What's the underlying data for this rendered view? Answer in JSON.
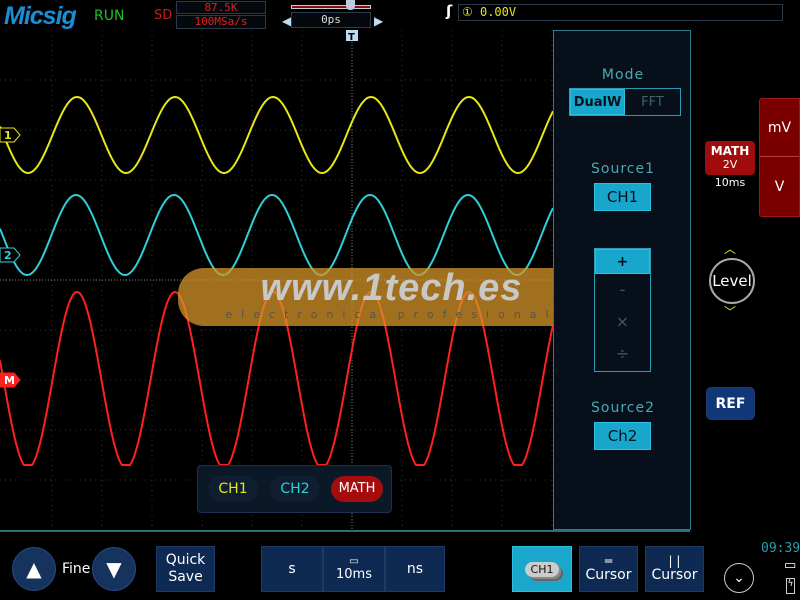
{
  "header": {
    "brand": "Micsig",
    "status": "RUN",
    "mode": "SD",
    "memory_depth": "87.5K",
    "sample_rate": "100MSa/s",
    "trigger_position": "0ps",
    "trigger_info": "① 0.00V",
    "trigger_slope_icon": "rising-edge-icon"
  },
  "channels": {
    "ch1_marker": "1",
    "ch2_marker": "2",
    "math_marker": "M",
    "trigger_marker": "T"
  },
  "colors": {
    "ch1": "#e6e619",
    "ch2": "#2fd0d8",
    "math": "#ff2020",
    "accent": "#18a6cc"
  },
  "channel_selector": {
    "ch1": "CH1",
    "ch2": "CH2",
    "math": "MATH"
  },
  "math_panel": {
    "mode_label": "Mode",
    "mode_options": [
      "DualW",
      "FFT"
    ],
    "mode_selected": "DualW",
    "source1_label": "Source1",
    "source1_value": "CH1",
    "operators": [
      "+",
      "-",
      "×",
      "÷"
    ],
    "operator_selected": "+",
    "source2_label": "Source2",
    "source2_value": "Ch2"
  },
  "right_side": {
    "math_badge": "MATH",
    "math_scale": "2V",
    "math_time": "10ms",
    "unit_mv": "mV",
    "unit_v": "V",
    "level": "Level",
    "ref": "REF"
  },
  "bottom": {
    "fine": "Fine",
    "quick_save": [
      "Quick",
      "Save"
    ],
    "time_s": "s",
    "timebase": "10ms",
    "time_ns": "ns",
    "ch1_stack": "CH1",
    "cursor_h": "Cursor",
    "cursor_v": "Cursor",
    "clock": "09:39"
  },
  "watermark": {
    "main": "www.1tech.es",
    "sub": "electronica profesional"
  }
}
